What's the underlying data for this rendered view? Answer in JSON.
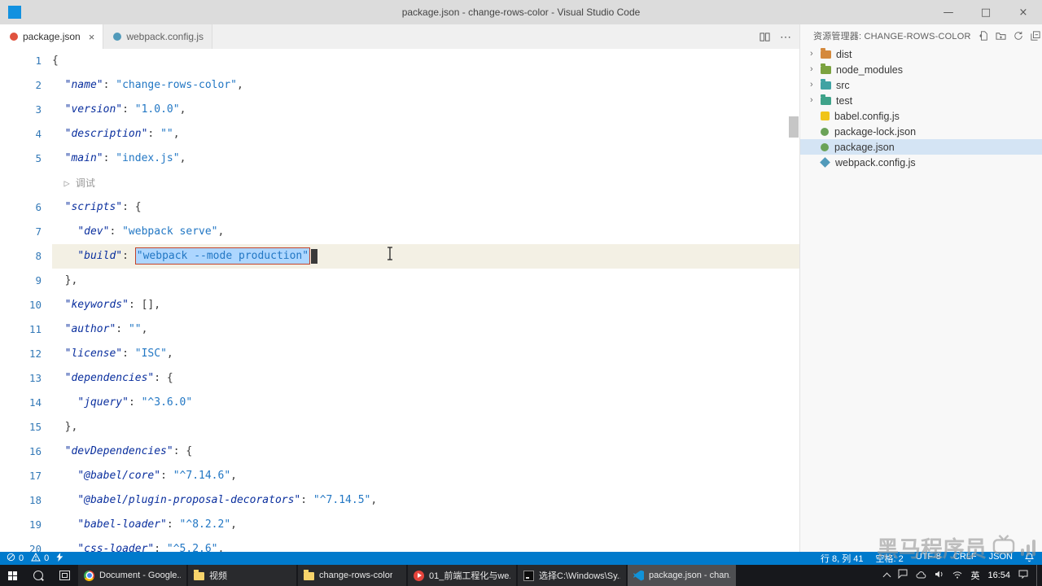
{
  "window": {
    "title": "package.json - change-rows-color - Visual Studio Code"
  },
  "icons": {
    "minimize": "—",
    "maximize": "□",
    "close": "×",
    "chevron": "›",
    "play": "▷",
    "more": "⋯"
  },
  "tabs": {
    "items": [
      {
        "label": "package.json",
        "active": true,
        "icon": "npm-icon",
        "icon_color": "#e0523e"
      },
      {
        "label": "webpack.config.js",
        "active": false,
        "icon": "webpack-icon",
        "icon_color": "#519aba"
      }
    ]
  },
  "editor": {
    "codelens": {
      "label": "调试"
    },
    "current_line": 8,
    "lines": [
      {
        "n": "1",
        "segs": [
          {
            "t": "{",
            "c": "p"
          }
        ]
      },
      {
        "n": "2",
        "segs": [
          {
            "t": "  ",
            "c": "p"
          },
          {
            "t": "\"name\"",
            "c": "k"
          },
          {
            "t": ": ",
            "c": "p"
          },
          {
            "t": "\"change-rows-color\"",
            "c": "s"
          },
          {
            "t": ",",
            "c": "p"
          }
        ]
      },
      {
        "n": "3",
        "segs": [
          {
            "t": "  ",
            "c": "p"
          },
          {
            "t": "\"version\"",
            "c": "k"
          },
          {
            "t": ": ",
            "c": "p"
          },
          {
            "t": "\"1.0.0\"",
            "c": "s"
          },
          {
            "t": ",",
            "c": "p"
          }
        ]
      },
      {
        "n": "4",
        "segs": [
          {
            "t": "  ",
            "c": "p"
          },
          {
            "t": "\"description\"",
            "c": "k"
          },
          {
            "t": ": ",
            "c": "p"
          },
          {
            "t": "\"\"",
            "c": "s"
          },
          {
            "t": ",",
            "c": "p"
          }
        ]
      },
      {
        "n": "5",
        "segs": [
          {
            "t": "  ",
            "c": "p"
          },
          {
            "t": "\"main\"",
            "c": "k"
          },
          {
            "t": ": ",
            "c": "p"
          },
          {
            "t": "\"index.js\"",
            "c": "s"
          },
          {
            "t": ",",
            "c": "p"
          }
        ]
      },
      {
        "codelens": true
      },
      {
        "n": "6",
        "segs": [
          {
            "t": "  ",
            "c": "p"
          },
          {
            "t": "\"scripts\"",
            "c": "k"
          },
          {
            "t": ": ",
            "c": "p"
          },
          {
            "t": "{",
            "c": "p"
          }
        ]
      },
      {
        "n": "7",
        "segs": [
          {
            "t": "    ",
            "c": "p"
          },
          {
            "t": "\"dev\"",
            "c": "k"
          },
          {
            "t": ": ",
            "c": "p"
          },
          {
            "t": "\"webpack serve\"",
            "c": "s"
          },
          {
            "t": ",",
            "c": "p"
          }
        ]
      },
      {
        "n": "8",
        "current": true,
        "cursor": true,
        "segs": [
          {
            "t": "    ",
            "c": "p"
          },
          {
            "t": "\"build\"",
            "c": "k"
          },
          {
            "t": ": ",
            "c": "p"
          },
          {
            "t": "\"webpack --mode production\"",
            "c": "s",
            "sel": true
          }
        ]
      },
      {
        "n": "9",
        "segs": [
          {
            "t": "  },",
            "c": "p"
          }
        ]
      },
      {
        "n": "10",
        "segs": [
          {
            "t": "  ",
            "c": "p"
          },
          {
            "t": "\"keywords\"",
            "c": "k"
          },
          {
            "t": ": ",
            "c": "p"
          },
          {
            "t": "[],",
            "c": "p"
          }
        ]
      },
      {
        "n": "11",
        "segs": [
          {
            "t": "  ",
            "c": "p"
          },
          {
            "t": "\"author\"",
            "c": "k"
          },
          {
            "t": ": ",
            "c": "p"
          },
          {
            "t": "\"\"",
            "c": "s"
          },
          {
            "t": ",",
            "c": "p"
          }
        ]
      },
      {
        "n": "12",
        "segs": [
          {
            "t": "  ",
            "c": "p"
          },
          {
            "t": "\"license\"",
            "c": "k"
          },
          {
            "t": ": ",
            "c": "p"
          },
          {
            "t": "\"ISC\"",
            "c": "s"
          },
          {
            "t": ",",
            "c": "p"
          }
        ]
      },
      {
        "n": "13",
        "segs": [
          {
            "t": "  ",
            "c": "p"
          },
          {
            "t": "\"dependencies\"",
            "c": "k"
          },
          {
            "t": ": ",
            "c": "p"
          },
          {
            "t": "{",
            "c": "p"
          }
        ]
      },
      {
        "n": "14",
        "segs": [
          {
            "t": "    ",
            "c": "p"
          },
          {
            "t": "\"jquery\"",
            "c": "k"
          },
          {
            "t": ": ",
            "c": "p"
          },
          {
            "t": "\"^3.6.0\"",
            "c": "s"
          }
        ]
      },
      {
        "n": "15",
        "segs": [
          {
            "t": "  },",
            "c": "p"
          }
        ]
      },
      {
        "n": "16",
        "segs": [
          {
            "t": "  ",
            "c": "p"
          },
          {
            "t": "\"devDependencies\"",
            "c": "k"
          },
          {
            "t": ": ",
            "c": "p"
          },
          {
            "t": "{",
            "c": "p"
          }
        ]
      },
      {
        "n": "17",
        "segs": [
          {
            "t": "    ",
            "c": "p"
          },
          {
            "t": "\"@babel/core\"",
            "c": "k"
          },
          {
            "t": ": ",
            "c": "p"
          },
          {
            "t": "\"^7.14.6\"",
            "c": "s"
          },
          {
            "t": ",",
            "c": "p"
          }
        ]
      },
      {
        "n": "18",
        "segs": [
          {
            "t": "    ",
            "c": "p"
          },
          {
            "t": "\"@babel/plugin-proposal-decorators\"",
            "c": "k"
          },
          {
            "t": ": ",
            "c": "p"
          },
          {
            "t": "\"^7.14.5\"",
            "c": "s"
          },
          {
            "t": ",",
            "c": "p"
          }
        ]
      },
      {
        "n": "19",
        "segs": [
          {
            "t": "    ",
            "c": "p"
          },
          {
            "t": "\"babel-loader\"",
            "c": "k"
          },
          {
            "t": ": ",
            "c": "p"
          },
          {
            "t": "\"^8.2.2\"",
            "c": "s"
          },
          {
            "t": ",",
            "c": "p"
          }
        ]
      },
      {
        "n": "20",
        "segs": [
          {
            "t": "    ",
            "c": "p"
          },
          {
            "t": "\"css-loader\"",
            "c": "k"
          },
          {
            "t": ": ",
            "c": "p"
          },
          {
            "t": "\"^5.2.6\"",
            "c": "s"
          },
          {
            "t": ",",
            "c": "p"
          }
        ]
      }
    ]
  },
  "explorer": {
    "header": "资源管理器: CHANGE-ROWS-COLOR",
    "items": [
      {
        "label": "dist",
        "type": "folder",
        "icon": "folder-icon",
        "color": "#d4893c"
      },
      {
        "label": "node_modules",
        "type": "folder",
        "icon": "folder-icon",
        "color": "#7ba23f"
      },
      {
        "label": "src",
        "type": "folder",
        "icon": "folder-icon",
        "color": "#3fa3a3"
      },
      {
        "label": "test",
        "type": "folder",
        "icon": "folder-icon",
        "color": "#3fa38a"
      },
      {
        "label": "babel.config.js",
        "type": "file",
        "icon": "babel-icon",
        "color": "#f0c419"
      },
      {
        "label": "package-lock.json",
        "type": "file",
        "icon": "npm-icon",
        "color": "#6aa257"
      },
      {
        "label": "package.json",
        "type": "file",
        "icon": "npm-icon",
        "color": "#6aa257",
        "selected": true
      },
      {
        "label": "webpack.config.js",
        "type": "file",
        "icon": "webpack-icon",
        "color": "#519aba"
      }
    ]
  },
  "status_bar": {
    "errors": "0",
    "warnings": "0",
    "items": [
      "行 8, 列 41",
      "空格: 2",
      "UTF-8",
      "CRLF",
      "JSON"
    ]
  },
  "taskbar": {
    "buttons": [
      {
        "label": "Document - Google...",
        "icon": "chrome-icon",
        "cls": "ai-chrome"
      },
      {
        "label": "视频",
        "icon": "folder-icon",
        "cls": "ai-folder"
      },
      {
        "label": "change-rows-color",
        "icon": "folder-icon",
        "cls": "ai-folder"
      },
      {
        "label": "01_前端工程化与we...",
        "icon": "media-player-icon",
        "cls": "ai-player"
      },
      {
        "label": "选择C:\\Windows\\Sy...",
        "icon": "cmd-icon",
        "cls": "ai-cmd"
      },
      {
        "label": "package.json - chan...",
        "icon": "vscode-icon",
        "cls": "ai-vscode",
        "active": true
      }
    ],
    "tray": {
      "language": "英",
      "time": "16:54"
    }
  },
  "watermark": {
    "text": "黑马程序员"
  }
}
